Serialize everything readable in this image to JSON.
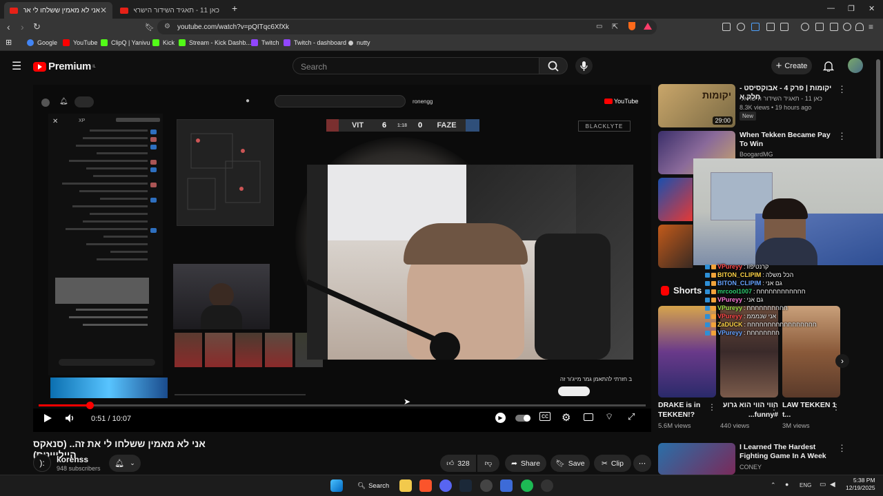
{
  "browser": {
    "tabs": [
      {
        "title": "אני לא מאמין ששלחו לי את זה..."
      },
      {
        "title": "כאן 11 - תאגיד השידור הישראלי - YouTube"
      }
    ],
    "url": "youtube.com/watch?v=pQITqc6XfXk",
    "bookmarks": [
      "Google",
      "YouTube",
      "ClipQ | Yanivu",
      "Kick",
      "Stream - Kick Dashb...",
      "Twitch",
      "Twitch - dashboard",
      "nutty"
    ]
  },
  "youtube": {
    "brand": "Premium",
    "region": "IL",
    "search_placeholder": "Search",
    "create_label": "Create"
  },
  "player": {
    "current_time": "0:51",
    "duration": "10:07",
    "time_display": "0:51 / 10:07",
    "progress_fraction": 0.084,
    "embedded": {
      "scoreboard": {
        "team_left": "VIT",
        "score_left": "6",
        "clock": "1:18",
        "score_right": "0",
        "team_right": "FAZE"
      },
      "sponsor": "BLACKLYTE",
      "channel": "ronengg",
      "yt_label": "YouTube",
      "tag_text": "XP"
    }
  },
  "video": {
    "title": "אני לא מאמין ששלחו לי את זה.. (סנאקס הייליייטס)",
    "channel": "korenss",
    "channel_avatar_text": "):",
    "subscribers": "948 subscribers",
    "likes": "328",
    "share_label": "Share",
    "save_label": "Save",
    "clip_label": "Clip"
  },
  "recommendations": [
    {
      "title": "יקומות | פרק 4 - אבוקסיסט - חלק א",
      "channel": "כאן 11 - תאגיד השידור הישראלי",
      "meta": "8.3K views • 19 hours ago",
      "duration": "29:00",
      "badge": "New",
      "thumb_text": "יקומות"
    },
    {
      "title": "When Tekken Became Pay To Win",
      "channel": "BoogardMG"
    },
    {
      "title": "I Learned The Hardest Fighting Game In A Week",
      "channel": "CONEY"
    }
  ],
  "shorts": {
    "label": "Shorts",
    "items": [
      {
        "title": "DRAKE is in TEKKEN!?",
        "views": "5.6M views"
      },
      {
        "title": "הווי הווי הוא גרוע #funny...",
        "views": "440 views"
      },
      {
        "title": "LAW TEKKEN 1 t...",
        "views": "3M views"
      }
    ]
  },
  "chat_overlay": [
    {
      "user": "VPureyy",
      "msg": "קרנטיפוו"
    },
    {
      "user": "BITON_CLIPIM",
      "msg": "הכל משלה"
    },
    {
      "user": "BITON_CLIPIM",
      "msg": "גם אני"
    },
    {
      "user": "mrcool1007",
      "msg": "חחחחחחחחחחחח"
    },
    {
      "user": "VPureyy",
      "msg": "גם אני"
    },
    {
      "user": "VPureyy",
      "msg": "חחחחחחחחחח"
    },
    {
      "user": "VPureyy",
      "msg": "אני שנמממ"
    },
    {
      "user": "ZaDUCK",
      "msg": "חחחחחחחחחחחחחחחחח"
    },
    {
      "user": "VPureyy",
      "msg": "חחחחחחחח"
    }
  ],
  "taskbar": {
    "search_label": "Search",
    "lang": "ENG",
    "time": "5:38 PM",
    "date": "12/19/2025"
  },
  "colors": {
    "accent": "#ff0000",
    "bg": "#0f0f0f",
    "chip": "#272727"
  }
}
